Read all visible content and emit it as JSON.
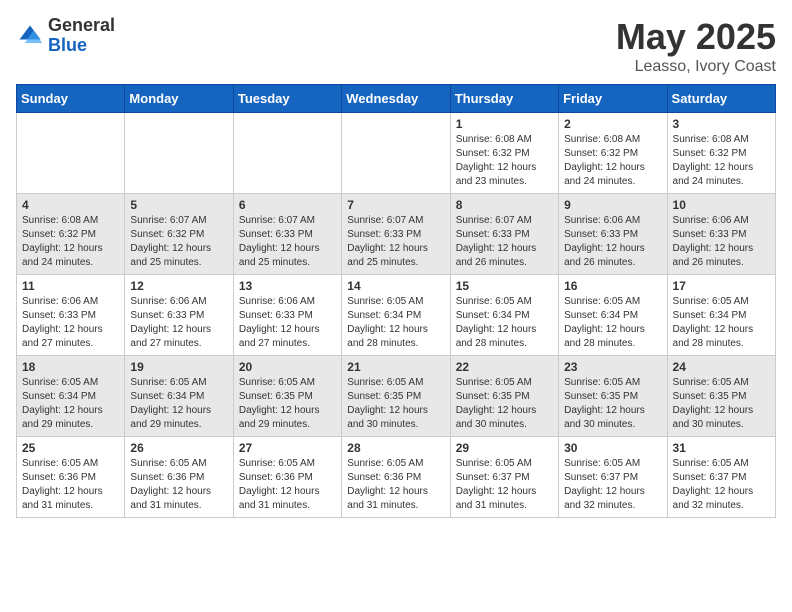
{
  "header": {
    "logo_general": "General",
    "logo_blue": "Blue",
    "month_title": "May 2025",
    "location": "Leasso, Ivory Coast"
  },
  "days_of_week": [
    "Sunday",
    "Monday",
    "Tuesday",
    "Wednesday",
    "Thursday",
    "Friday",
    "Saturday"
  ],
  "weeks": [
    [
      {
        "day": "",
        "content": ""
      },
      {
        "day": "",
        "content": ""
      },
      {
        "day": "",
        "content": ""
      },
      {
        "day": "",
        "content": ""
      },
      {
        "day": "1",
        "content": "Sunrise: 6:08 AM\nSunset: 6:32 PM\nDaylight: 12 hours\nand 23 minutes."
      },
      {
        "day": "2",
        "content": "Sunrise: 6:08 AM\nSunset: 6:32 PM\nDaylight: 12 hours\nand 24 minutes."
      },
      {
        "day": "3",
        "content": "Sunrise: 6:08 AM\nSunset: 6:32 PM\nDaylight: 12 hours\nand 24 minutes."
      }
    ],
    [
      {
        "day": "4",
        "content": "Sunrise: 6:08 AM\nSunset: 6:32 PM\nDaylight: 12 hours\nand 24 minutes."
      },
      {
        "day": "5",
        "content": "Sunrise: 6:07 AM\nSunset: 6:32 PM\nDaylight: 12 hours\nand 25 minutes."
      },
      {
        "day": "6",
        "content": "Sunrise: 6:07 AM\nSunset: 6:33 PM\nDaylight: 12 hours\nand 25 minutes."
      },
      {
        "day": "7",
        "content": "Sunrise: 6:07 AM\nSunset: 6:33 PM\nDaylight: 12 hours\nand 25 minutes."
      },
      {
        "day": "8",
        "content": "Sunrise: 6:07 AM\nSunset: 6:33 PM\nDaylight: 12 hours\nand 26 minutes."
      },
      {
        "day": "9",
        "content": "Sunrise: 6:06 AM\nSunset: 6:33 PM\nDaylight: 12 hours\nand 26 minutes."
      },
      {
        "day": "10",
        "content": "Sunrise: 6:06 AM\nSunset: 6:33 PM\nDaylight: 12 hours\nand 26 minutes."
      }
    ],
    [
      {
        "day": "11",
        "content": "Sunrise: 6:06 AM\nSunset: 6:33 PM\nDaylight: 12 hours\nand 27 minutes."
      },
      {
        "day": "12",
        "content": "Sunrise: 6:06 AM\nSunset: 6:33 PM\nDaylight: 12 hours\nand 27 minutes."
      },
      {
        "day": "13",
        "content": "Sunrise: 6:06 AM\nSunset: 6:33 PM\nDaylight: 12 hours\nand 27 minutes."
      },
      {
        "day": "14",
        "content": "Sunrise: 6:05 AM\nSunset: 6:34 PM\nDaylight: 12 hours\nand 28 minutes."
      },
      {
        "day": "15",
        "content": "Sunrise: 6:05 AM\nSunset: 6:34 PM\nDaylight: 12 hours\nand 28 minutes."
      },
      {
        "day": "16",
        "content": "Sunrise: 6:05 AM\nSunset: 6:34 PM\nDaylight: 12 hours\nand 28 minutes."
      },
      {
        "day": "17",
        "content": "Sunrise: 6:05 AM\nSunset: 6:34 PM\nDaylight: 12 hours\nand 28 minutes."
      }
    ],
    [
      {
        "day": "18",
        "content": "Sunrise: 6:05 AM\nSunset: 6:34 PM\nDaylight: 12 hours\nand 29 minutes."
      },
      {
        "day": "19",
        "content": "Sunrise: 6:05 AM\nSunset: 6:34 PM\nDaylight: 12 hours\nand 29 minutes."
      },
      {
        "day": "20",
        "content": "Sunrise: 6:05 AM\nSunset: 6:35 PM\nDaylight: 12 hours\nand 29 minutes."
      },
      {
        "day": "21",
        "content": "Sunrise: 6:05 AM\nSunset: 6:35 PM\nDaylight: 12 hours\nand 30 minutes."
      },
      {
        "day": "22",
        "content": "Sunrise: 6:05 AM\nSunset: 6:35 PM\nDaylight: 12 hours\nand 30 minutes."
      },
      {
        "day": "23",
        "content": "Sunrise: 6:05 AM\nSunset: 6:35 PM\nDaylight: 12 hours\nand 30 minutes."
      },
      {
        "day": "24",
        "content": "Sunrise: 6:05 AM\nSunset: 6:35 PM\nDaylight: 12 hours\nand 30 minutes."
      }
    ],
    [
      {
        "day": "25",
        "content": "Sunrise: 6:05 AM\nSunset: 6:36 PM\nDaylight: 12 hours\nand 31 minutes."
      },
      {
        "day": "26",
        "content": "Sunrise: 6:05 AM\nSunset: 6:36 PM\nDaylight: 12 hours\nand 31 minutes."
      },
      {
        "day": "27",
        "content": "Sunrise: 6:05 AM\nSunset: 6:36 PM\nDaylight: 12 hours\nand 31 minutes."
      },
      {
        "day": "28",
        "content": "Sunrise: 6:05 AM\nSunset: 6:36 PM\nDaylight: 12 hours\nand 31 minutes."
      },
      {
        "day": "29",
        "content": "Sunrise: 6:05 AM\nSunset: 6:37 PM\nDaylight: 12 hours\nand 31 minutes."
      },
      {
        "day": "30",
        "content": "Sunrise: 6:05 AM\nSunset: 6:37 PM\nDaylight: 12 hours\nand 32 minutes."
      },
      {
        "day": "31",
        "content": "Sunrise: 6:05 AM\nSunset: 6:37 PM\nDaylight: 12 hours\nand 32 minutes."
      }
    ]
  ]
}
